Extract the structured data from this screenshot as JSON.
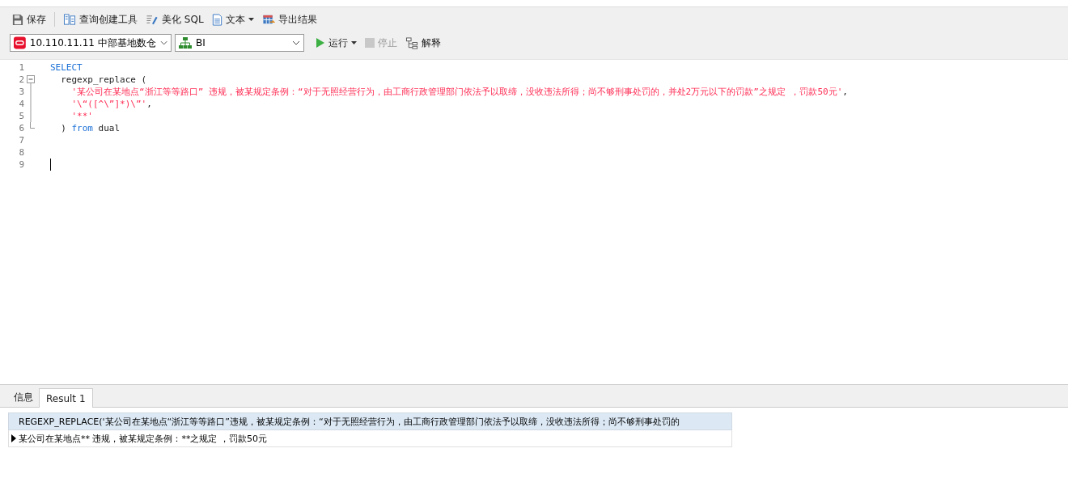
{
  "toolbar": [
    {
      "kind": "save",
      "label": "保存",
      "has_menu": false
    },
    {
      "kind": "query-builder",
      "label": "查询创建工具",
      "has_menu": false
    },
    {
      "kind": "beautify",
      "label": "美化 SQL",
      "has_menu": false
    },
    {
      "kind": "document",
      "label": "文本",
      "has_menu": true
    },
    {
      "kind": "export",
      "label": "导出结果",
      "has_menu": false
    }
  ],
  "connection": {
    "value": "10.110.11.11 中部基地数仓"
  },
  "database": {
    "value": "BI"
  },
  "actions": [
    {
      "kind": "run",
      "label": "运行",
      "has_menu": true,
      "disabled": false
    },
    {
      "kind": "stop",
      "label": "停止",
      "has_menu": false,
      "disabled": true
    },
    {
      "kind": "explain",
      "label": "解释",
      "has_menu": false,
      "disabled": false
    }
  ],
  "editor": {
    "lines": [
      {
        "number": "1",
        "kind": "plain",
        "cursor": false,
        "tokens": [
          {
            "kind": "keyword",
            "text": "SELECT"
          }
        ]
      },
      {
        "number": "2",
        "kind": "fold-start",
        "cursor": false,
        "tokens": [
          {
            "kind": "plain",
            "text": "  regexp_replace ("
          }
        ]
      },
      {
        "number": "3",
        "kind": "fold-body",
        "cursor": false,
        "tokens": [
          {
            "kind": "string",
            "text": "    '某公司在某地点“浙江等等路口” 违规，被某规定条例：“对于无照经营行为，由工商行政管理部门依法予以取缔，没收违法所得；尚不够刑事处罚的，并处2万元以下的罚款”之规定 ，罚款50元'"
          },
          {
            "kind": "plain",
            "text": ","
          }
        ]
      },
      {
        "number": "4",
        "kind": "fold-body",
        "cursor": false,
        "tokens": [
          {
            "kind": "string",
            "text": "    '\\“([^\\”]*)\\”'"
          },
          {
            "kind": "plain",
            "text": ","
          }
        ]
      },
      {
        "number": "5",
        "kind": "fold-body",
        "cursor": false,
        "tokens": [
          {
            "kind": "string",
            "text": "    '**'"
          }
        ]
      },
      {
        "number": "6",
        "kind": "fold-end",
        "cursor": false,
        "tokens": [
          {
            "kind": "plain",
            "text": "  ) "
          },
          {
            "kind": "keyword",
            "text": "from"
          },
          {
            "kind": "plain",
            "text": " dual"
          }
        ]
      },
      {
        "number": "7",
        "kind": "plain",
        "cursor": false
      },
      {
        "number": "8",
        "kind": "plain",
        "cursor": false
      },
      {
        "number": "9",
        "kind": "plain",
        "cursor": true
      }
    ]
  },
  "result_tabs": [
    {
      "label": "信息",
      "selected": false
    },
    {
      "label": "Result 1",
      "selected": true
    }
  ],
  "result_grid": {
    "columns": [
      "REGEXP_REPLACE('某公司在某地点“浙江等等路口”违规，被某规定条例：“对于无照经营行为，由工商行政管理部门依法予以取缔，没收违法所得；尚不够刑事处罚的"
    ],
    "rows": [
      {
        "current": true,
        "cells": [
          "某公司在某地点** 违规，被某规定条例：**之规定 ，罚款50元"
        ]
      }
    ]
  }
}
